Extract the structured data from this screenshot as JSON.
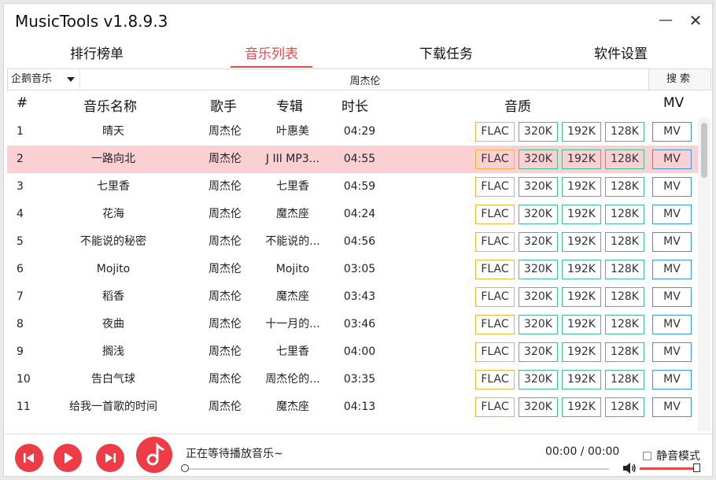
{
  "window": {
    "title": "MusicTools v1.8.9.3",
    "minimize_glyph": "—",
    "close_glyph": "✕"
  },
  "tabs": [
    {
      "label": "排行榜单",
      "active": false
    },
    {
      "label": "音乐列表",
      "active": true
    },
    {
      "label": "下载任务",
      "active": false
    },
    {
      "label": "软件设置",
      "active": false
    }
  ],
  "search": {
    "source": "企鹅音乐",
    "query": "周杰伦",
    "button": "搜索"
  },
  "columns": {
    "index": "#",
    "name": "音乐名称",
    "artist": "歌手",
    "album": "专辑",
    "duration": "时长",
    "quality": "音质",
    "mv": "MV"
  },
  "quality_labels": [
    "FLAC",
    "320K",
    "192K",
    "128K"
  ],
  "mv_label": "MV",
  "songs": [
    {
      "index": "1",
      "name": "晴天",
      "artist": "周杰伦",
      "album": "叶惠美",
      "duration": "04:29"
    },
    {
      "index": "2",
      "name": "一路向北",
      "artist": "周杰伦",
      "album": "J III MP3...",
      "duration": "04:55",
      "selected": true
    },
    {
      "index": "3",
      "name": "七里香",
      "artist": "周杰伦",
      "album": "七里香",
      "duration": "04:59"
    },
    {
      "index": "4",
      "name": "花海",
      "artist": "周杰伦",
      "album": "魔杰座",
      "duration": "04:24"
    },
    {
      "index": "5",
      "name": "不能说的秘密",
      "artist": "周杰伦",
      "album": "不能说的...",
      "duration": "04:56"
    },
    {
      "index": "6",
      "name": "Mojito",
      "artist": "周杰伦",
      "album": "Mojito",
      "duration": "03:05"
    },
    {
      "index": "7",
      "name": "稻香",
      "artist": "周杰伦",
      "album": "魔杰座",
      "duration": "03:43"
    },
    {
      "index": "8",
      "name": "夜曲",
      "artist": "周杰伦",
      "album": "十一月的...",
      "duration": "03:46"
    },
    {
      "index": "9",
      "name": "搁浅",
      "artist": "周杰伦",
      "album": "七里香",
      "duration": "04:00"
    },
    {
      "index": "10",
      "name": "告白气球",
      "artist": "周杰伦",
      "album": "周杰伦的...",
      "duration": "03:35"
    },
    {
      "index": "11",
      "name": "给我一首歌的时间",
      "artist": "周杰伦",
      "album": "魔杰座",
      "duration": "04:13"
    }
  ],
  "player": {
    "status": "正在等待播放音乐~",
    "time": "00:00 / 00:00",
    "progress": 0,
    "mute_label": "静音模式",
    "muted": false,
    "volume": 1.0
  },
  "colors": {
    "accent": "#e8474d",
    "player_button": "#ee3c47",
    "selected_row": "#fbd0d3",
    "flac_border": "#f0b534",
    "bitrate_border": "#3fbf8e",
    "mv_border": "#3a95e0"
  }
}
